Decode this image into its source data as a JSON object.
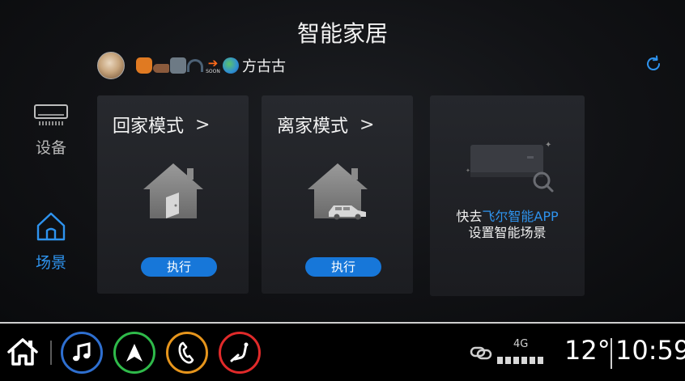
{
  "header": {
    "title": "智能家居"
  },
  "user": {
    "name": "方古古",
    "soon_badge": "SOON",
    "icons": [
      "backpack-icon",
      "shoe-icon",
      "camera-icon",
      "headphones-icon",
      "soon-arrow-icon",
      "globe-icon"
    ]
  },
  "sidebar": {
    "items": [
      {
        "label": "设备",
        "icon": "air-conditioner-icon",
        "active": false
      },
      {
        "label": "场景",
        "icon": "house-icon",
        "active": true
      }
    ]
  },
  "scenes": [
    {
      "title": "回家模式",
      "chevron": ">",
      "button": "执行",
      "icon": "house-door-icon"
    },
    {
      "title": "离家模式",
      "chevron": ">",
      "button": "执行",
      "icon": "house-car-icon"
    }
  ],
  "promo": {
    "prefix": "快去",
    "app_name": "飞尔智能APP",
    "line2": "设置智能场景"
  },
  "status_bar": {
    "network": "4G",
    "temperature": "12°",
    "time": "10:59"
  },
  "dock": {
    "apps": [
      "music-icon",
      "navigation-icon",
      "phone-icon",
      "seat-icon"
    ]
  },
  "colors": {
    "accent": "#1777d9",
    "highlight": "#2e93ee",
    "music": "#2e6fd0",
    "nav": "#2fba4a",
    "phone": "#e6951c",
    "seat": "#e02a2a"
  }
}
